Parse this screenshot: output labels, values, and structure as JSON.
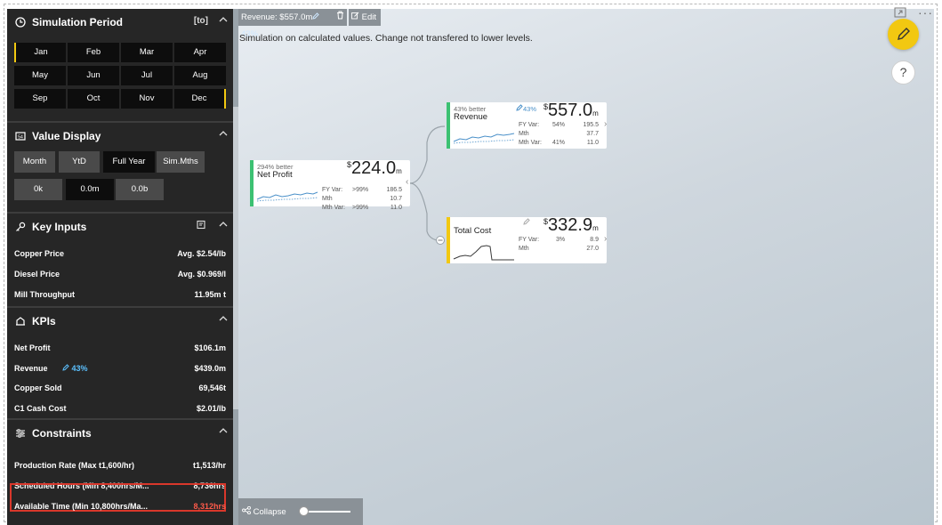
{
  "left_panel": {
    "simulation_period": {
      "title": "Simulation Period",
      "extra": "[to]",
      "months": [
        "Jan",
        "Feb",
        "Mar",
        "Apr",
        "May",
        "Jun",
        "Jul",
        "Aug",
        "Sep",
        "Oct",
        "Nov",
        "Dec"
      ]
    },
    "value_display": {
      "title": "Value Display",
      "period_buttons": [
        "Month",
        "YtD",
        "Full Year",
        "Sim.Mths"
      ],
      "selected_period": "Full Year",
      "scale_buttons": [
        "0k",
        "0.0m",
        "0.0b"
      ],
      "selected_scale": "0.0m"
    },
    "key_inputs": {
      "title": "Key Inputs",
      "rows": [
        {
          "label": "Copper Price",
          "value": "Avg. $2.54/lb"
        },
        {
          "label": "Diesel Price",
          "value": "Avg. $0.969/l"
        },
        {
          "label": "Mill Throughput",
          "value": "11.95m t"
        }
      ]
    },
    "kpis": {
      "title": "KPIs",
      "rows": [
        {
          "label": "Net Profit",
          "value": "$106.1m",
          "badge": ""
        },
        {
          "label": "Revenue",
          "value": "$439.0m",
          "badge": "43%"
        },
        {
          "label": "Copper Sold",
          "value": "69,546t",
          "badge": ""
        },
        {
          "label": "C1 Cash Cost",
          "value": "$2.01/lb",
          "badge": ""
        }
      ]
    },
    "constraints": {
      "title": "Constraints",
      "rows": [
        {
          "label": "Production Rate (Max t1,600/hr)",
          "value": "t1,513/hr"
        },
        {
          "label": "Scheduled Hours (Min 8,400hrs/M...",
          "value": "8,736hrs"
        },
        {
          "label": "Available Time (Min 10,800hrs/Ma...",
          "value": "8,312hrs"
        }
      ]
    }
  },
  "canvas": {
    "toolbar": {
      "revenue_chip": "Revenue: $557.0m",
      "revenue_pct": "43%",
      "edit_label": "Edit"
    },
    "info_text": "Simulation on calculated values. Change not transfered to lower levels.",
    "collapse_label": "Collapse",
    "cards": {
      "net_profit": {
        "better": "294% better",
        "name": "Net Profit",
        "currency": "$",
        "value": "224.0",
        "unit": "m",
        "rows": [
          {
            "a": "FY Var:",
            "b": ">99%",
            "c": "186.5"
          },
          {
            "a": "Mth",
            "b": "",
            "c": "10.7"
          },
          {
            "a": "Mth Var:",
            "b": ">99%",
            "c": "11.0"
          }
        ],
        "accent": "#3cc172"
      },
      "revenue": {
        "better": "43% better",
        "edit_pct": "43%",
        "name": "Revenue",
        "currency": "$",
        "value": "557.0",
        "unit": "m",
        "rows": [
          {
            "a": "FY Var:",
            "b": "54%",
            "c": "195.5"
          },
          {
            "a": "Mth",
            "b": "",
            "c": "37.7"
          },
          {
            "a": "Mth Var:",
            "b": "41%",
            "c": "11.0"
          }
        ],
        "accent": "#3cc172"
      },
      "total_cost": {
        "name": "Total Cost",
        "currency": "$",
        "value": "332.9",
        "unit": "m",
        "rows": [
          {
            "a": "FY Var:",
            "b": "3%",
            "c": "8.9"
          },
          {
            "a": "Mth",
            "b": "",
            "c": "27.0"
          }
        ],
        "accent": "#f2c811"
      }
    }
  },
  "colors": {
    "panel_bg": "#262626",
    "accent_yellow": "#f2c811",
    "alert_red": "#d9372b",
    "positive_green": "#3cc172",
    "link_blue": "#5cc1ff"
  }
}
